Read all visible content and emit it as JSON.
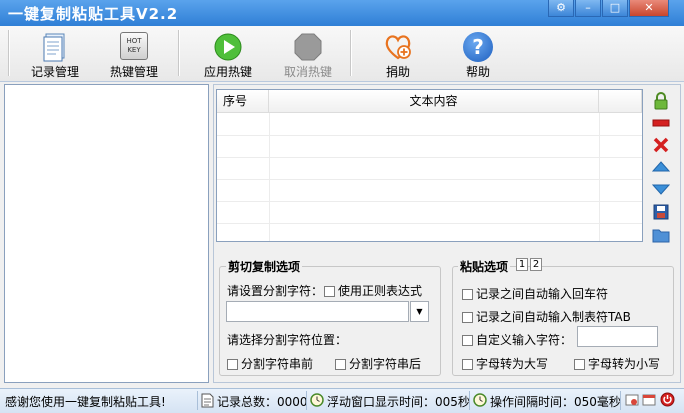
{
  "window": {
    "title": "一键复制粘贴工具V2.2",
    "buttons": {
      "settings": "⚙",
      "minimize": "–",
      "maximize": "□",
      "close": "✕"
    }
  },
  "toolbar": {
    "records": "记录管理",
    "hotkeys": "热键管理",
    "apply_hotkey": "应用热键",
    "cancel_hotkey": "取消热键",
    "donate": "捐助",
    "help": "帮助",
    "hotkey_icon_text": "HOT KEY",
    "help_icon_text": "?"
  },
  "table": {
    "columns": [
      "序号",
      "文本内容"
    ]
  },
  "cut_copy": {
    "title": "剪切复制选项",
    "set_separator": "请设置分割字符：",
    "use_regex": "使用正则表达式",
    "separator_value": "",
    "dropdown_icon": "▼",
    "select_position": "请选择分割字符位置：",
    "before": "分割字符串前",
    "after": "分割字符串后"
  },
  "paste": {
    "title": "粘贴选项",
    "tab1": "1",
    "tab2": "2",
    "auto_enter": "记录之间自动输入回车符",
    "auto_tab": "记录之间自动输入制表符TAB",
    "custom_char": "自定义输入字符：",
    "custom_value": "",
    "uppercase": "字母转为大写",
    "lowercase": "字母转为小写"
  },
  "status": {
    "welcome": "感谢您使用一键复制粘贴工具!",
    "record_count": "记录总数：0000",
    "float_time": "浮动窗口显示时间：005秒",
    "interval": "操作间隔时间：050毫秒"
  },
  "colors": {
    "titlebar": "#2f7fd6",
    "lock_green": "#5a9e2a",
    "remove_red": "#d42020",
    "arrow_blue": "#3b8fd8"
  }
}
